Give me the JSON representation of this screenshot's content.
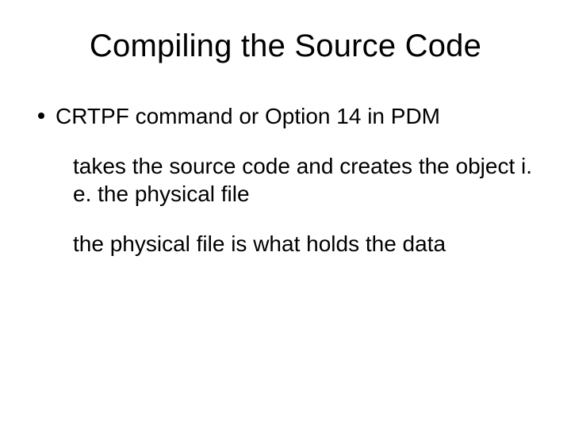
{
  "title": "Compiling the Source Code",
  "bullets": [
    {
      "text": "CRTPF command or Option 14 in PDM",
      "subs": [
        "takes the source code and creates the object i. e. the physical file",
        "the physical file is what holds the data"
      ]
    }
  ]
}
